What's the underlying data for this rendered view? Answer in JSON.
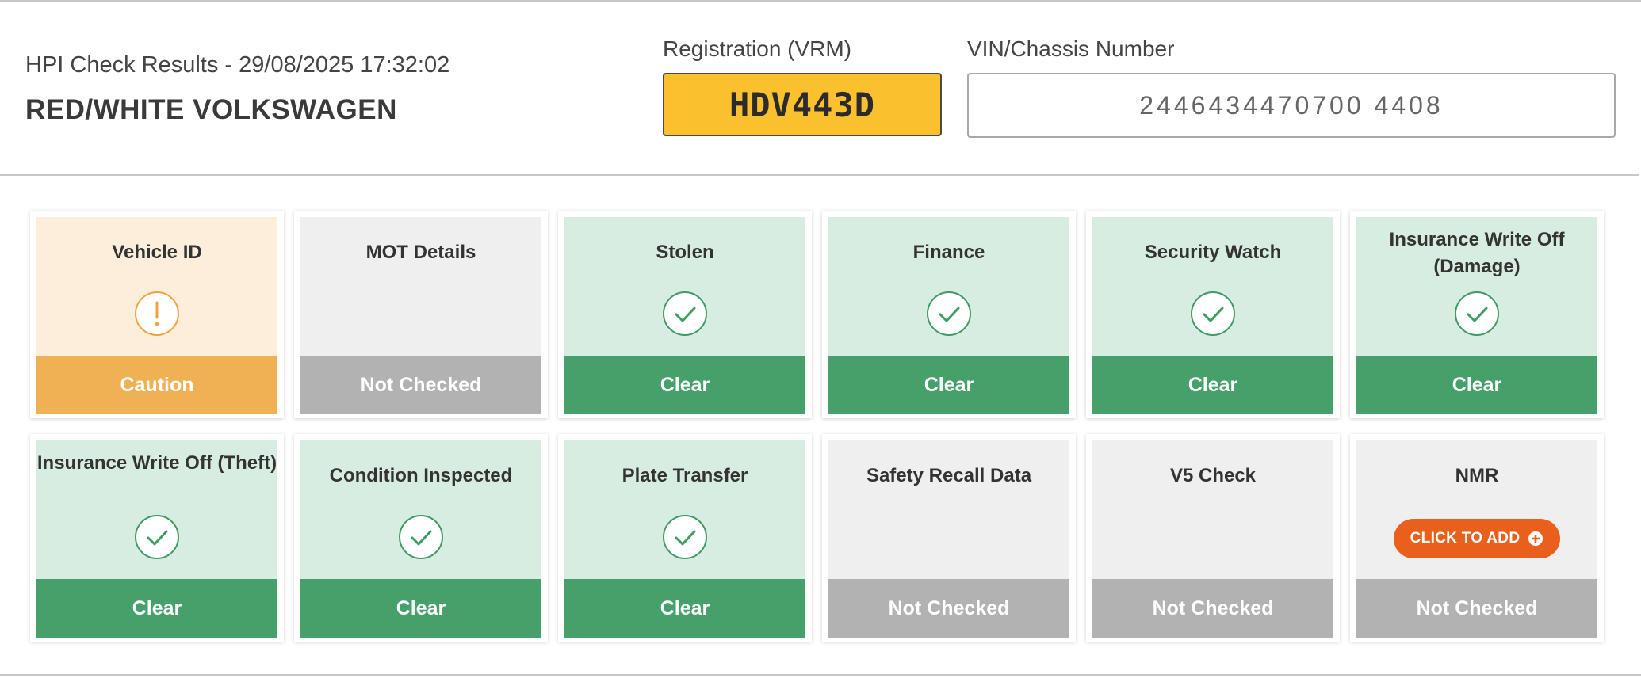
{
  "header": {
    "results_line": "HPI Check Results - 29/08/2025 17:32:02",
    "vehicle_title": "RED/WHITE VOLKSWAGEN",
    "registration_label": "Registration (VRM)",
    "registration_value": "HDV443D",
    "vin_label": "VIN/Chassis Number",
    "vin_value": "2446434470700 4408"
  },
  "colors": {
    "caution_body": "#fdeedb",
    "caution_status": "#f0b054",
    "caution_icon": "#f0a33a",
    "clear_body": "#d8ede1",
    "clear_status": "#46a06a",
    "clear_icon": "#3f9a63",
    "not_checked_body": "#efefef",
    "not_checked_status": "#b2b2b2",
    "add_button": "#e8601c",
    "plate": "#fbc02d"
  },
  "checks": [
    {
      "title": "Vehicle ID",
      "status": "Caution",
      "state": "caution",
      "icon": "exclamation-icon"
    },
    {
      "title": "MOT Details",
      "status": "Not Checked",
      "state": "grey",
      "icon": ""
    },
    {
      "title": "Stolen",
      "status": "Clear",
      "state": "clear",
      "icon": "check-icon"
    },
    {
      "title": "Finance",
      "status": "Clear",
      "state": "clear",
      "icon": "check-icon"
    },
    {
      "title": "Security Watch",
      "status": "Clear",
      "state": "clear",
      "icon": "check-icon"
    },
    {
      "title": "Insurance Write Off (Damage)",
      "status": "Clear",
      "state": "clear",
      "icon": "check-icon"
    },
    {
      "title": "Insurance Write Off (Theft)",
      "status": "Clear",
      "state": "clear",
      "icon": "check-icon"
    },
    {
      "title": "Condition Inspected",
      "status": "Clear",
      "state": "clear",
      "icon": "check-icon"
    },
    {
      "title": "Plate Transfer",
      "status": "Clear",
      "state": "clear",
      "icon": "check-icon"
    },
    {
      "title": "Safety Recall Data",
      "status": "Not Checked",
      "state": "grey",
      "icon": ""
    },
    {
      "title": "V5 Check",
      "status": "Not Checked",
      "state": "grey",
      "icon": ""
    },
    {
      "title": "NMR",
      "status": "Not Checked",
      "state": "grey",
      "icon": "",
      "action_label": "CLICK TO ADD",
      "action_icon": "plus-circle-icon"
    }
  ]
}
